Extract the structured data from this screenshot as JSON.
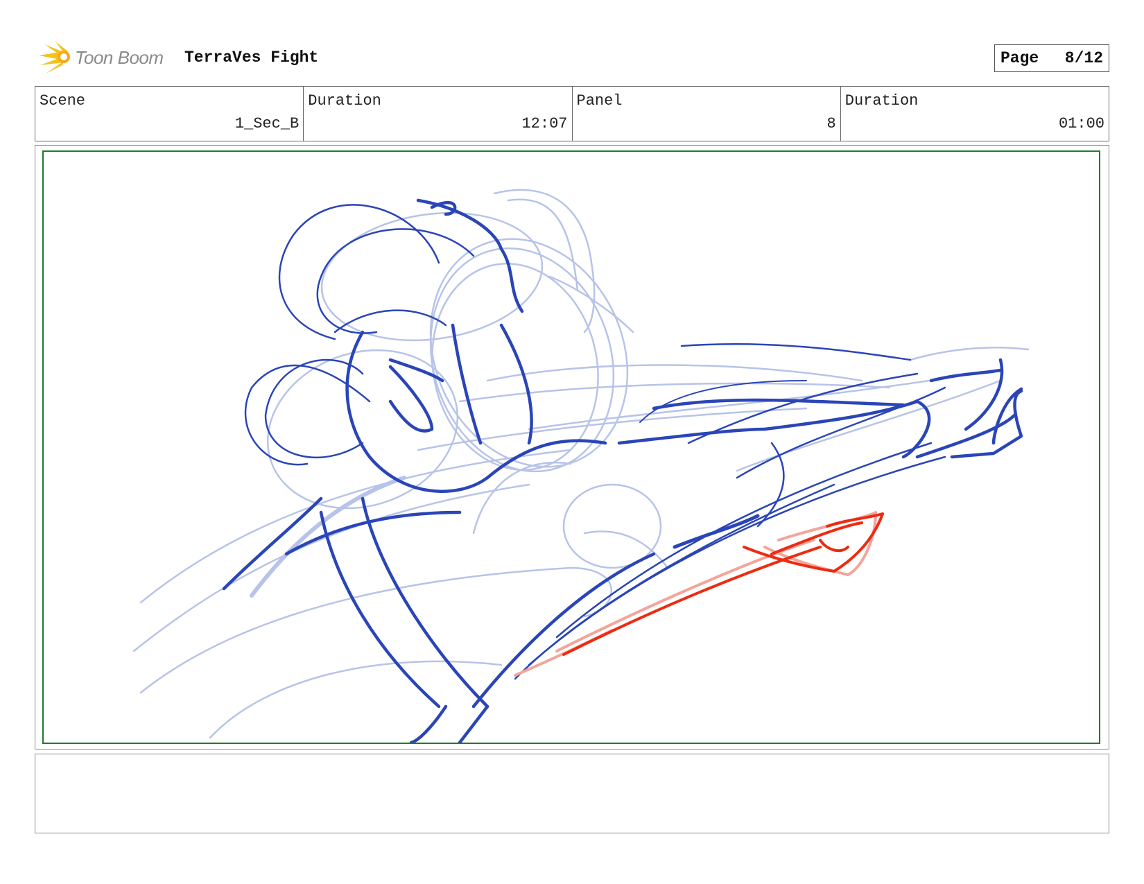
{
  "header": {
    "logo_text": "Toon Boom",
    "project_title": "TerraVes Fight",
    "page_label": "Page",
    "page_number": "8/12"
  },
  "info": {
    "scene_label": "Scene",
    "scene_value": "1_Sec_B",
    "scene_duration_label": "Duration",
    "scene_duration_value": "12:07",
    "panel_label": "Panel",
    "panel_value": "8",
    "panel_duration_label": "Duration",
    "panel_duration_value": "01:00"
  },
  "colors": {
    "frame_green": "#1f7a2b",
    "sketch_dark_blue": "#2a45b8",
    "sketch_light_blue": "#b7c3e8",
    "sketch_red": "#ee2a10",
    "sketch_pink": "#f3a59a",
    "logo_yellow": "#f6c21a"
  },
  "icons": {
    "logo": "toon-boom-starburst-icon"
  },
  "notes": ""
}
